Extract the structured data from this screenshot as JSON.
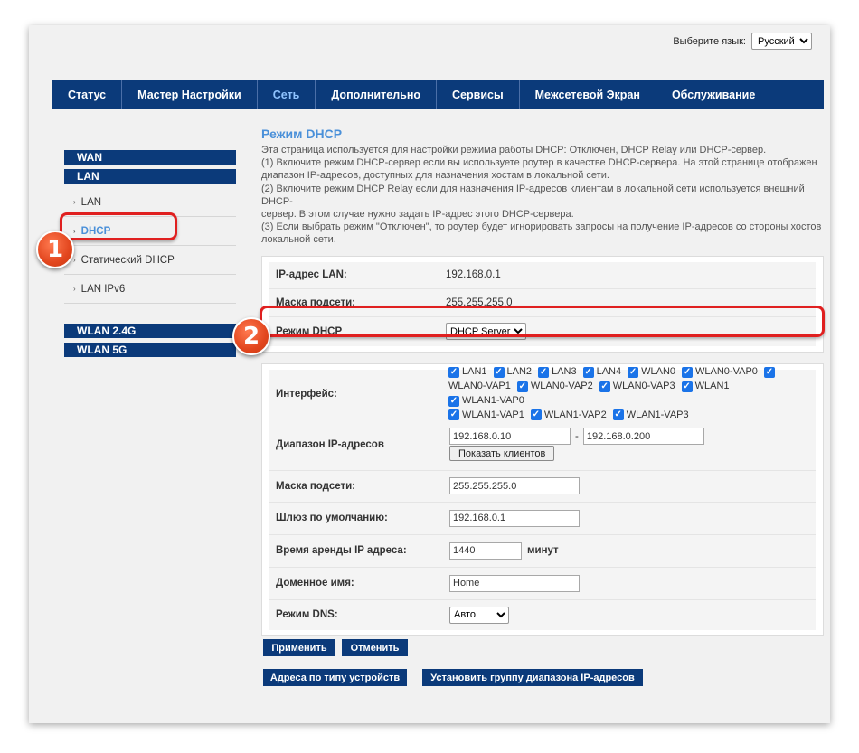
{
  "language": {
    "label": "Выберите язык:",
    "selected": "Русский"
  },
  "nav": [
    "Статус",
    "Мастер Настройки",
    "Сеть",
    "Дополнительно",
    "Сервисы",
    "Межсетевой Экран",
    "Обслуживание"
  ],
  "sidebar": {
    "wan": "WAN",
    "lan": "LAN",
    "lan_items": [
      "LAN",
      "DHCP",
      "Статический DHCP",
      "LAN IPv6"
    ],
    "wlan24": "WLAN 2.4G",
    "wlan5": "WLAN 5G"
  },
  "page": {
    "title": "Режим DHCP",
    "desc": [
      "Эта страница используется для настройки режима работы DHCP: Отключен, DHCP Relay или DHCP-сервер.",
      "(1) Включите режим DHCP-сервер если вы используете роутер в качестве DHCP-сервера. На этой странице отображен",
      "диапазон IP-адресов, доступных для назначения хостам в локальной сети.",
      "(2) Включите режим DHCP Relay если для назначения IP-адресов клиентам в локальной сети используется внешний DHCP-",
      "сервер. В этом случае нужно задать IP-адрес этого DHCP-сервера.",
      "(3) Если выбрать режим \"Отключен\", то роутер будет игнорировать запросы на получение IP-адресов со стороны хостов",
      "локальной сети."
    ]
  },
  "info": {
    "lan_ip_label": "IP-адрес LAN:",
    "lan_ip": "192.168.0.1",
    "mask_label": "Маска подсети:",
    "mask": "255.255.255.0",
    "mode_label": "Режим DHCP",
    "mode": "DHCP Server"
  },
  "dhcp": {
    "iface_label": "Интерфейс:",
    "interfaces_line1": [
      "LAN1",
      "LAN2",
      "LAN3",
      "LAN4",
      "WLAN0",
      "WLAN0-VAP0"
    ],
    "interfaces_line2": [
      "WLAN0-VAP1",
      "WLAN0-VAP2",
      "WLAN0-VAP3",
      "WLAN1",
      "WLAN1-VAP0"
    ],
    "interfaces_line3": [
      "WLAN1-VAP1",
      "WLAN1-VAP2",
      "WLAN1-VAP3"
    ],
    "range_label": "Диапазон IP-адресов",
    "range_start": "192.168.0.10",
    "range_sep": "-",
    "range_end": "192.168.0.200",
    "show_clients": "Показать клиентов",
    "mask_label": "Маска подсети:",
    "mask": "255.255.255.0",
    "gateway_label": "Шлюз по умолчанию:",
    "gateway": "192.168.0.1",
    "lease_label": "Время аренды IP адреса:",
    "lease": "1440",
    "lease_unit": "минут",
    "domain_label": "Доменное имя:",
    "domain": "Home",
    "dns_label": "Режим DNS:",
    "dns": "Авто"
  },
  "buttons": {
    "apply": "Применить",
    "cancel": "Отменить",
    "addr_by_type": "Адреса по типу устройств",
    "set_group": "Установить группу диапазона IP-адресов"
  },
  "callouts": [
    "1",
    "2"
  ]
}
